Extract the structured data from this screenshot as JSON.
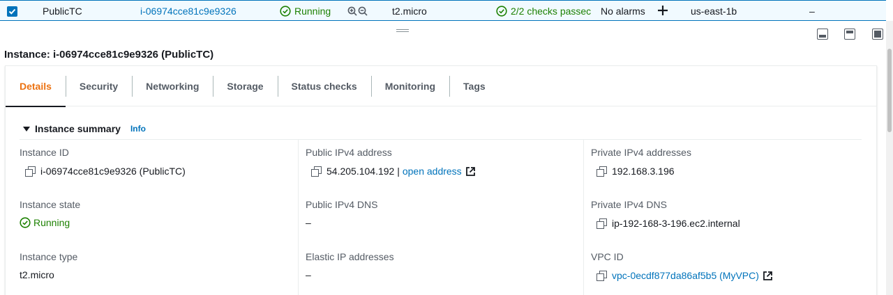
{
  "row": {
    "name": "PublicTC",
    "instance_id": "i-06974cce81c9e9326",
    "state": "Running",
    "type": "t2.micro",
    "status_checks": "2/2 checks passec",
    "alarms": "No alarms",
    "az": "us-east-1b",
    "ipv4_dns": "–"
  },
  "instance_title": "Instance: i-06974cce81c9e9326 (PublicTC)",
  "tabs": [
    {
      "label": "Details"
    },
    {
      "label": "Security"
    },
    {
      "label": "Networking"
    },
    {
      "label": "Storage"
    },
    {
      "label": "Status checks"
    },
    {
      "label": "Monitoring"
    },
    {
      "label": "Tags"
    }
  ],
  "summary": {
    "title": "Instance summary",
    "info_label": "Info"
  },
  "fields": {
    "instance_id": {
      "label": "Instance ID",
      "value": "i-06974cce81c9e9326 (PublicTC)"
    },
    "instance_state": {
      "label": "Instance state",
      "value": "Running"
    },
    "instance_type": {
      "label": "Instance type",
      "value": "t2.micro"
    },
    "public_ipv4": {
      "label": "Public IPv4 address",
      "value": "54.205.104.192 |",
      "link": "open address"
    },
    "public_dns": {
      "label": "Public IPv4 DNS",
      "value": "–"
    },
    "elastic_ip": {
      "label": "Elastic IP addresses",
      "value": "–"
    },
    "private_ipv4": {
      "label": "Private IPv4 addresses",
      "value": "192.168.3.196"
    },
    "private_dns": {
      "label": "Private IPv4 DNS",
      "value": "ip-192-168-3-196.ec2.internal"
    },
    "vpc_id": {
      "label": "VPC ID",
      "value": "vpc-0ecdf877da86af5b5 (MyVPC)"
    }
  },
  "colors": {
    "accent": "#0073bb",
    "success": "#1d8102",
    "active_tab": "#ec7211"
  }
}
